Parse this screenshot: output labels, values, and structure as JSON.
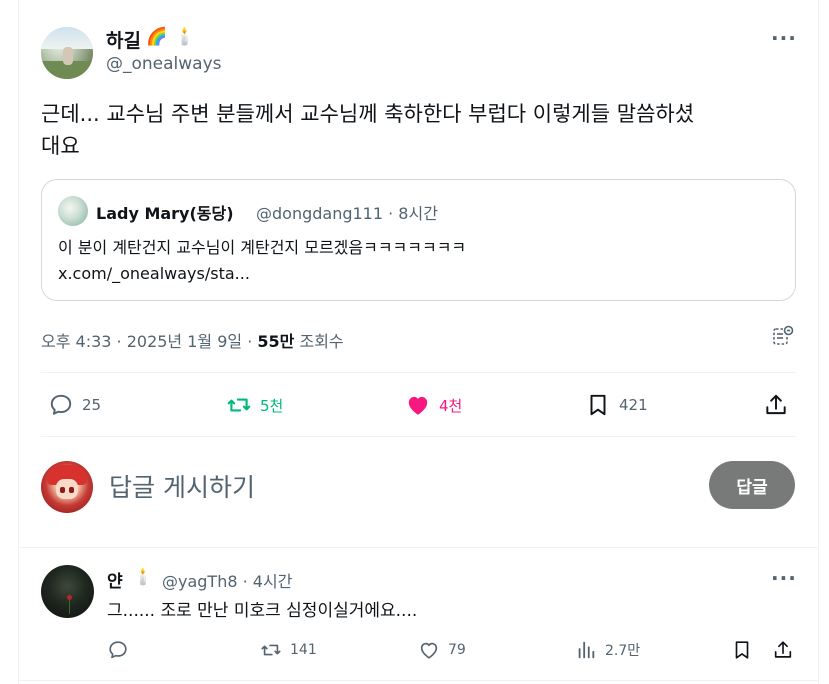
{
  "tweet": {
    "author_name": "하길",
    "author_emojis": [
      "🌈",
      "🕯️"
    ],
    "handle": "@_onealways",
    "more_label": "···",
    "text_line1": "근데... 교수님 주변 분들께서 교수님께 축하한다 부럽다 이렇게들 말씀하셨",
    "text_line2": "대요",
    "quote": {
      "author_name": "Lady Mary(동당)",
      "handle_time": "@dongdang111 · 8시간",
      "text": "이 분이 계탄건지 교수님이 계탄건지 모르겠음ㅋㅋㅋㅋㅋㅋㅋ",
      "link": "x.com/_onealways/sta..."
    },
    "meta": {
      "time_date": "오후 4:33 · 2025년 1월 9일 · ",
      "views_count": "55만",
      "views_label": " 조회수"
    },
    "actions": {
      "replies": "25",
      "retweets": "5천",
      "likes": "4천",
      "bookmarks": "421"
    },
    "colors": {
      "retweet": "#00ba7c",
      "like": "#f91880",
      "muted": "#536471",
      "text": "#0f1419"
    }
  },
  "composer": {
    "placeholder": "답글 게시하기",
    "reply_button": "답글"
  },
  "reply": {
    "author_name": "얀",
    "author_emoji": "🕯️",
    "handle_time": "@yagTh8 · 4시간",
    "more_label": "···",
    "text": "그...... 조로 만난 미호크 심정이실거에요....",
    "actions": {
      "replies": "",
      "retweets": "141",
      "likes": "79",
      "views": "2.7만"
    }
  }
}
